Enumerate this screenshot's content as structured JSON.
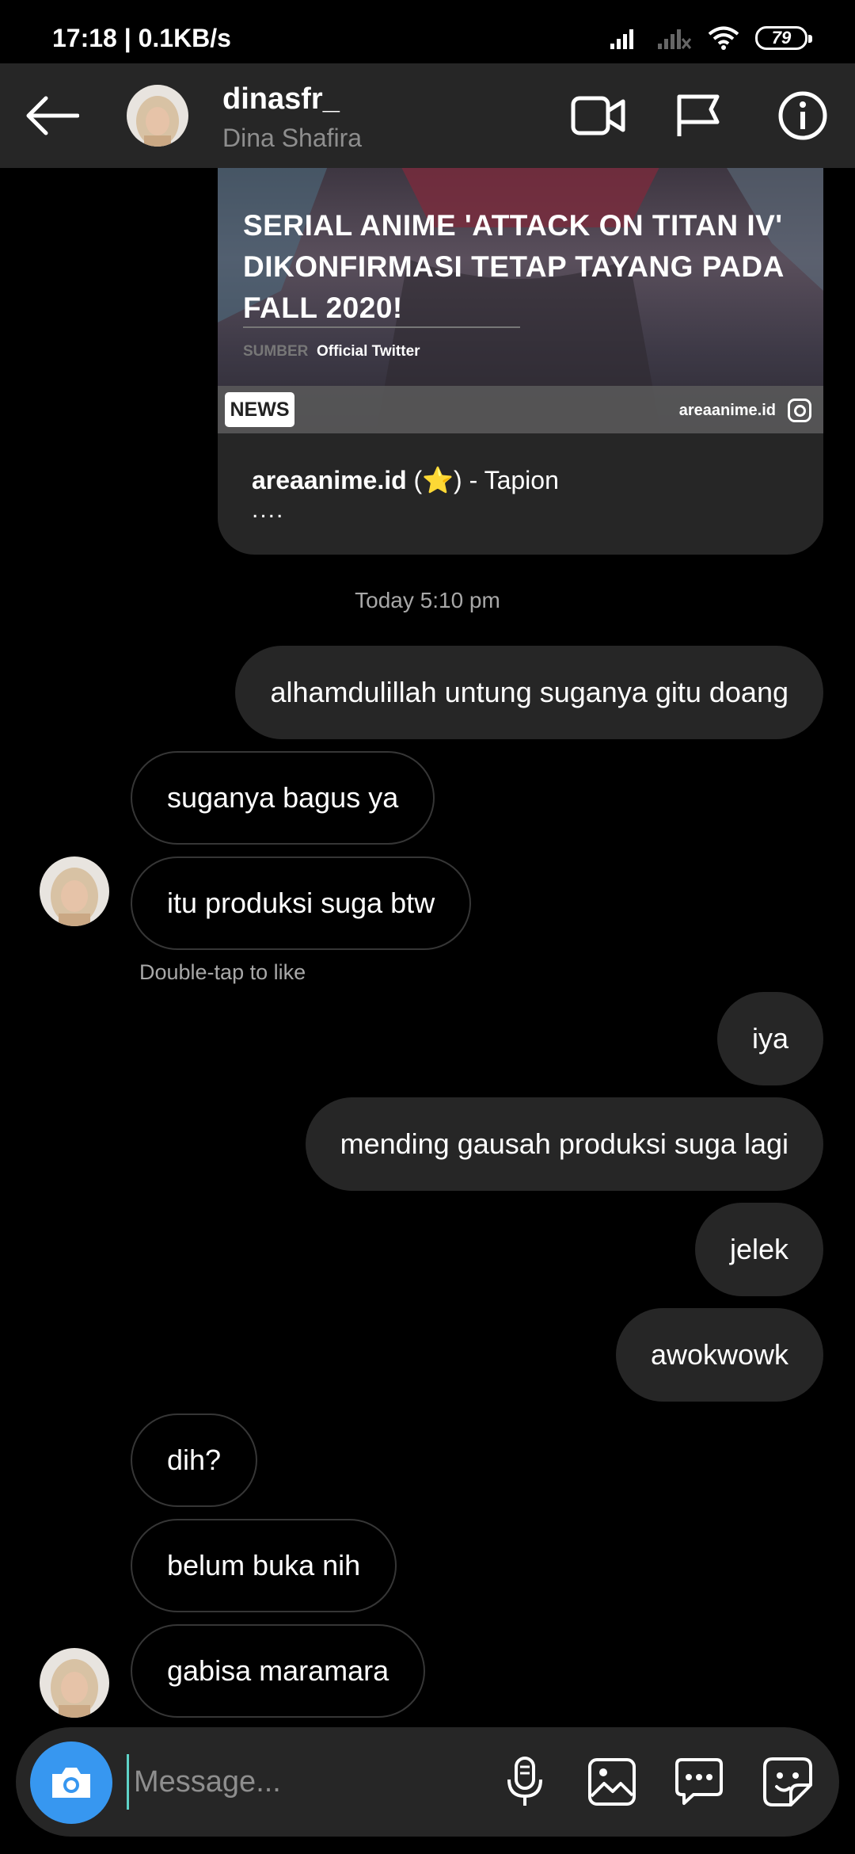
{
  "status_bar": {
    "time": "17:18 | 0.1KB/s",
    "battery": "79"
  },
  "header": {
    "username": "dinasfr_",
    "display_name": "Dina Shafira"
  },
  "shared_post": {
    "headline": "SERIAL ANIME 'ATTACK ON TITAN IV' DIKONFIRMASI TETAP TAYANG PADA FALL 2020!",
    "source_label": "SUMBER",
    "source_value": "Official Twitter",
    "badge": "NEWS",
    "site": "areaanime.id",
    "caption_account": "areaanime.id",
    "caption_rest": " (⭐) - Tapion",
    "caption_more": "...."
  },
  "timestamp": "Today 5:10 pm",
  "messages": [
    {
      "side": "sent",
      "text": "alhamdulillah untung suganya gitu doang"
    },
    {
      "side": "received",
      "text": "suganya bagus ya"
    },
    {
      "side": "received",
      "text": "itu produksi suga btw"
    },
    {
      "side": "sent",
      "text": "iya"
    },
    {
      "side": "sent",
      "text": "mending gausah produksi suga lagi"
    },
    {
      "side": "sent",
      "text": "jelek"
    },
    {
      "side": "sent",
      "text": "awokwowk"
    },
    {
      "side": "received",
      "text": "dih?"
    },
    {
      "side": "received",
      "text": "belum buka nih"
    },
    {
      "side": "received",
      "text": "gabisa maramara"
    }
  ],
  "hint": "Double-tap to like",
  "composer": {
    "placeholder": "Message..."
  },
  "colors": {
    "background": "#000000",
    "sent_bubble": "#262626",
    "received_border": "#363636",
    "camera_button": "#3797f0",
    "secondary_text": "#8e8e8e"
  },
  "icons": {
    "back": "arrow-left-icon",
    "video": "video-camera-icon",
    "flag": "flag-icon",
    "info": "info-icon",
    "camera": "camera-icon",
    "mic": "microphone-icon",
    "gallery": "image-icon",
    "reply": "chat-bubble-icon",
    "sticker": "sticker-icon"
  }
}
